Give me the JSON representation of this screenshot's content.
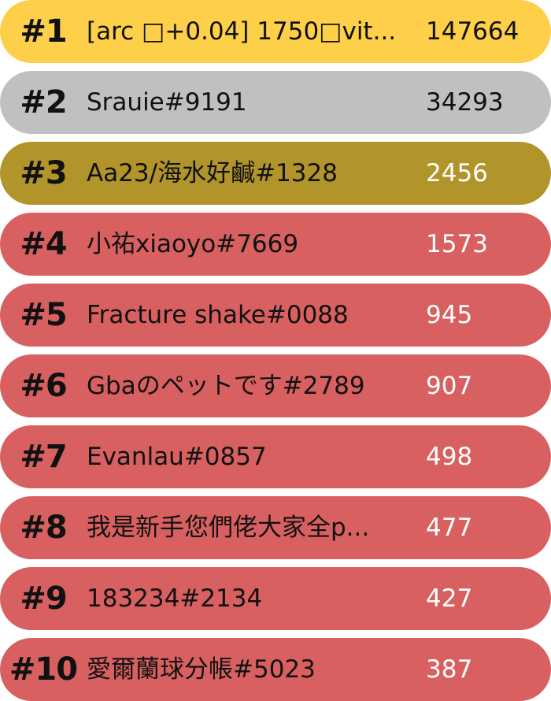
{
  "colors": {
    "gold": "#fed049",
    "silver": "#c0c0c0",
    "bronze": "#b1952a",
    "rest": "#d86060",
    "text_dark": "#111111",
    "text_light": "#ffffff"
  },
  "leaderboard": {
    "entries": [
      {
        "rank": "#1",
        "name": "[arc □+0.04] 1750□vit...",
        "score": "147664",
        "tier": "gold"
      },
      {
        "rank": "#2",
        "name": "Srauie#9191",
        "score": "34293",
        "tier": "silver"
      },
      {
        "rank": "#3",
        "name": "Aa23/海水好鹹#1328",
        "score": "2456",
        "tier": "bronze"
      },
      {
        "rank": "#4",
        "name": "小祐xiaoyo#7669",
        "score": "1573",
        "tier": "rest"
      },
      {
        "rank": "#5",
        "name": "Fracture shake#0088",
        "score": "945",
        "tier": "rest"
      },
      {
        "rank": "#6",
        "name": "Gbaのペットです#2789",
        "score": "907",
        "tier": "rest"
      },
      {
        "rank": "#7",
        "name": "Evanlau#0857",
        "score": "498",
        "tier": "rest"
      },
      {
        "rank": "#8",
        "name": "我是新手您們佬大家全p...",
        "score": "477",
        "tier": "rest"
      },
      {
        "rank": "#9",
        "name": "183234#2134",
        "score": "427",
        "tier": "rest"
      },
      {
        "rank": "#10",
        "name": "愛爾蘭球分帳#5023",
        "score": "387",
        "tier": "rest"
      }
    ]
  }
}
